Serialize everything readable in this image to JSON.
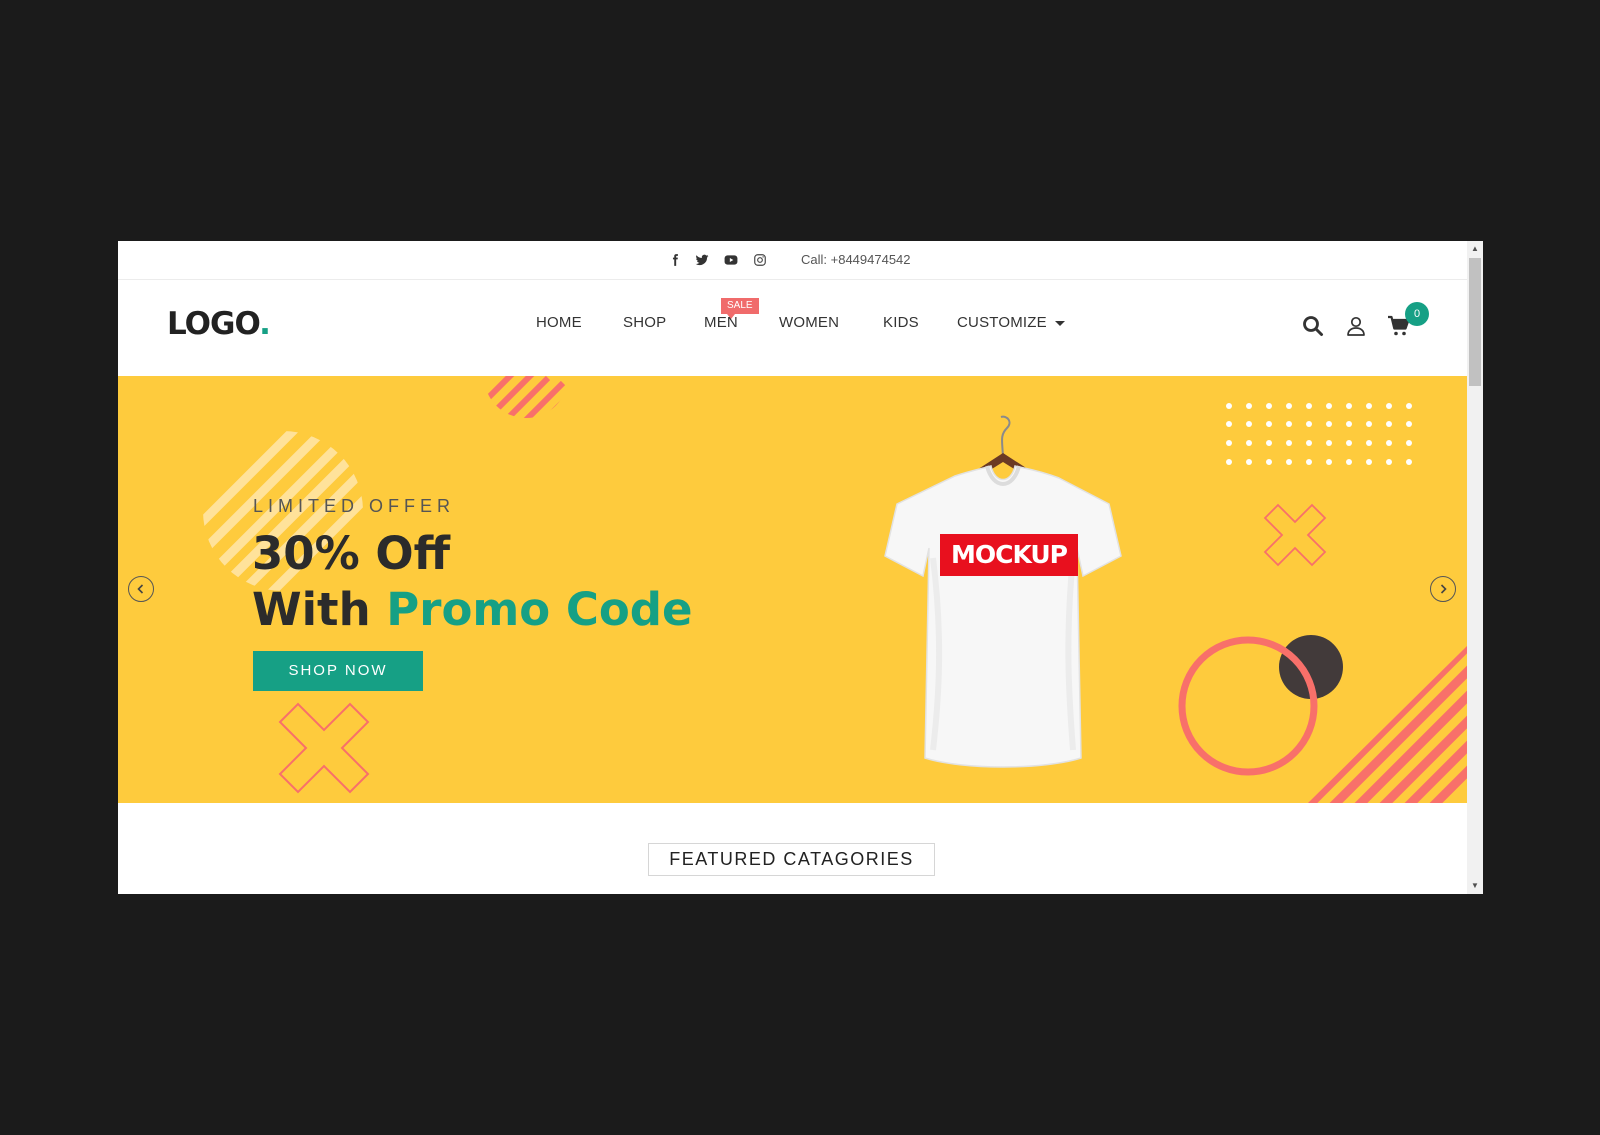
{
  "topbar": {
    "socials": [
      "facebook-icon",
      "twitter-icon",
      "youtube-icon",
      "instagram-icon"
    ],
    "call": "Call: +8449474542"
  },
  "header": {
    "logo": "LOGO",
    "logo_dot": ".",
    "nav": [
      "HOME",
      "SHOP",
      "MEN",
      "WOMEN",
      "KIDS",
      "CUSTOMIZE"
    ],
    "sale_badge": "SALE",
    "cart_count": "0",
    "icons": [
      "search-icon",
      "user-icon",
      "cart-icon"
    ]
  },
  "hero": {
    "kicker": "LIMITED OFFER",
    "headline_line1": "30% Off",
    "headline_line2_prefix": "With ",
    "headline_line2_accent": "Promo Code",
    "cta": "SHOP NOW",
    "shirt_print": "MOCKUP"
  },
  "featured": {
    "title": "FEATURED CATAGORIES"
  },
  "colors": {
    "accent": "#16a085",
    "hero_bg": "#fecb3d",
    "coral": "#f8706a",
    "dark": "#2b2b2b"
  }
}
